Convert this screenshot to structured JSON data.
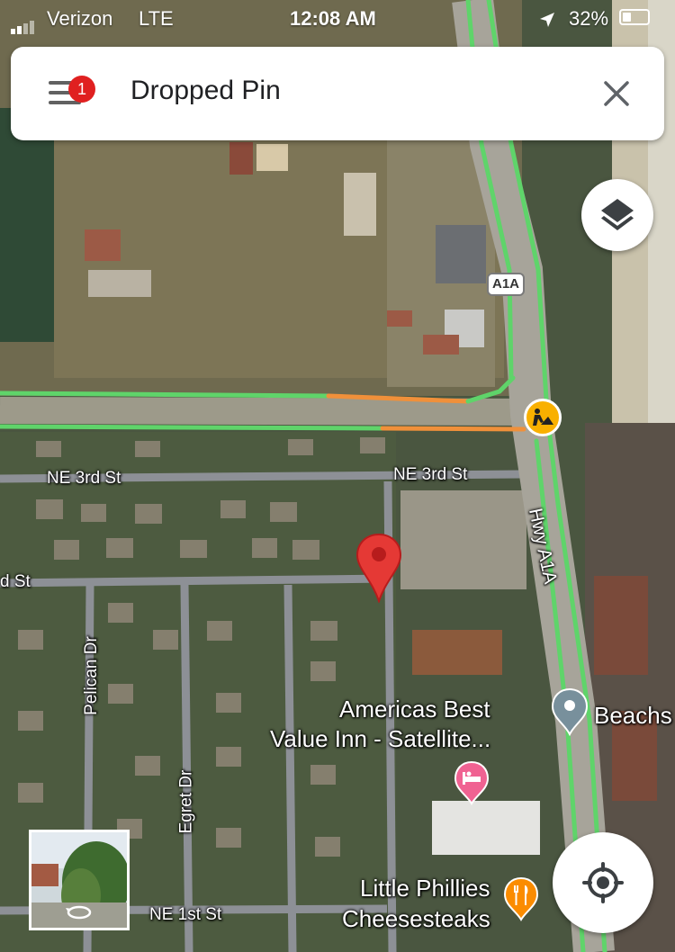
{
  "status_bar": {
    "carrier": "Verizon",
    "network": "LTE",
    "time": "12:08 AM",
    "battery": "32%"
  },
  "search_bar": {
    "title": "Dropped Pin",
    "notification_count": "1",
    "menu_icon": "hamburger-menu-icon",
    "close_icon": "close-icon"
  },
  "map": {
    "type": "satellite",
    "traffic_colors": {
      "free_flow": "#5fd46a",
      "slow": "#f0903a"
    },
    "highway_shield": "A1A",
    "streets": {
      "ne_3rd_st_west": "NE 3rd St",
      "ne_3rd_st_east": "NE 3rd St",
      "d_st": "d St",
      "hwy_a1a": "Hwy A1A",
      "pelican_dr": "Pelican Dr",
      "egret_dr": "Egret Dr",
      "ne_1st_st": "NE 1st St"
    },
    "places": {
      "hotel_line1": "Americas Best",
      "hotel_line2": "Value Inn - Satellite...",
      "restaurant_line1": "Little Phillies",
      "restaurant_line2": "Cheesesteaks",
      "beach": "Beachs"
    },
    "pins": {
      "dropped": {
        "color": "#e53935",
        "icon": "dropped-pin-icon"
      },
      "hotel": {
        "color": "#f06292",
        "icon": "bed-icon"
      },
      "restaurant": {
        "color": "#fb8c00",
        "icon": "fork-knife-icon"
      },
      "beach": {
        "color": "#78909c",
        "icon": "place-pin-icon"
      }
    },
    "roadwork_icon": "construction-worker-icon"
  },
  "controls": {
    "layers_icon": "layers-icon",
    "locate_icon": "my-location-icon",
    "street_view_icon": "rotate-360-icon"
  }
}
